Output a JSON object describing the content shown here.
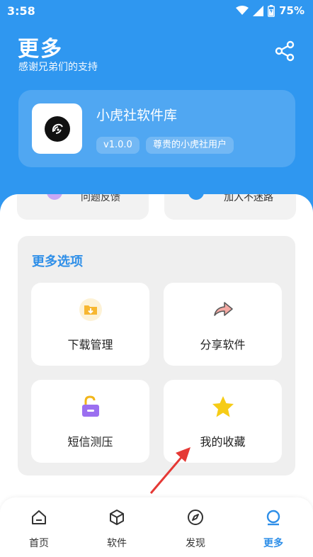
{
  "status": {
    "time": "3:58",
    "battery": "75%"
  },
  "header": {
    "title": "更多",
    "subtitle": "感谢兄弟们的支持",
    "share_icon": "share-icon"
  },
  "profile": {
    "app_name": "小虎社软件库",
    "version": "v1.0.0",
    "user_badge": "尊贵的小虎社用户"
  },
  "quick_actions": [
    {
      "label": "问题反馈"
    },
    {
      "label": "加入不迷路"
    }
  ],
  "options": {
    "title": "更多选项",
    "items": [
      {
        "label": "下载管理",
        "icon": "download-folder-icon"
      },
      {
        "label": "分享软件",
        "icon": "share-arrow-icon"
      },
      {
        "label": "短信测压",
        "icon": "unlock-icon"
      },
      {
        "label": "我的收藏",
        "icon": "star-icon"
      }
    ]
  },
  "nav": [
    {
      "label": "首页",
      "icon": "home-icon"
    },
    {
      "label": "软件",
      "icon": "cube-icon"
    },
    {
      "label": "发现",
      "icon": "compass-icon"
    },
    {
      "label": "更多",
      "icon": "more-icon",
      "active": true
    }
  ],
  "colors": {
    "primary": "#2f97f0",
    "accent_text": "#2f8fe8",
    "annotation_arrow": "#e53935"
  }
}
